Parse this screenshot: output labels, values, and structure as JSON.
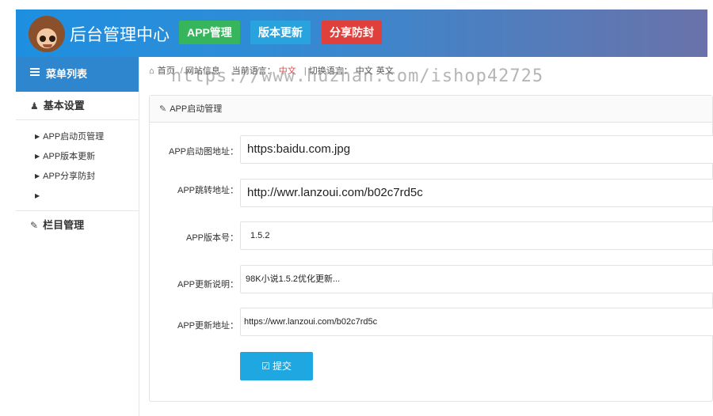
{
  "header": {
    "title": "后台管理中心",
    "buttons": [
      {
        "label": "APP管理",
        "color": "#36b55c"
      },
      {
        "label": "版本更新",
        "color": "#29a3de"
      },
      {
        "label": "分享防封",
        "color": "#e0403b"
      }
    ]
  },
  "sidebar": {
    "menu_title": "菜单列表",
    "section1": "基本设置",
    "items": [
      "APP启动页管理",
      "APP版本更新",
      "APP分享防封",
      ""
    ],
    "section2": "栏目管理"
  },
  "breadcrumb": {
    "home_icon": "home-icon",
    "home": "首页",
    "site": "网站信息",
    "lang_label": "当前语言：",
    "lang_current": "中文",
    "switch_label": "切换语言：",
    "lang_cn": "中文",
    "lang_en": "英文"
  },
  "watermark": "https://www.huzhan.com/ishop42725",
  "panel": {
    "title": "APP启动管理",
    "fields": [
      {
        "label": "APP启动图地址：",
        "value": "https:baidu.com.jpg"
      },
      {
        "label": "APP跳转地址：",
        "value": "http://wwr.lanzoui.com/b02c7rd5c"
      },
      {
        "label": "APP版本号：",
        "value": "1.5.2"
      },
      {
        "label": "APP更新说明：",
        "value": "98K小说1.5.2优化更新..."
      },
      {
        "label": "APP更新地址：",
        "value": "https://wwr.lanzoui.com/b02c7rd5c"
      }
    ],
    "submit_label": "提交"
  },
  "colors": {
    "header_start": "#1e8fe0",
    "menu_head": "#2e86cf",
    "submit": "#1ea7e1",
    "active_lang": "#d9534f"
  }
}
